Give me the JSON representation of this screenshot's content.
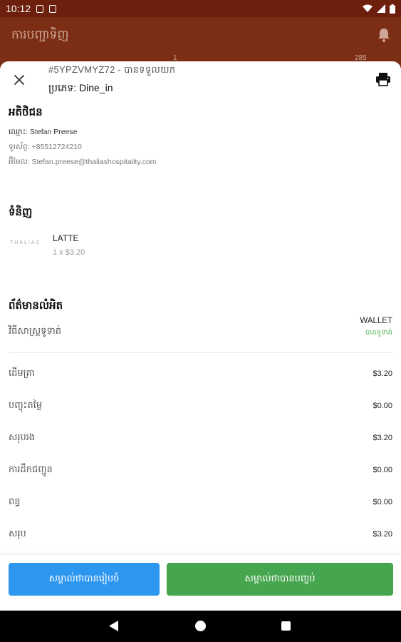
{
  "status_bar": {
    "time": "10:12"
  },
  "app_bar": {
    "title": "ការបញ្ជាទិញ",
    "count_left": "1",
    "count_right": "285"
  },
  "sheet": {
    "order_line": "#5YPZVMYZ72 - បានទទួលយក",
    "order_type": "ប្រភេទ: Dine_in"
  },
  "customer": {
    "title": "អតិថិជន",
    "name_label": "ឈ្មោះ:",
    "name": "Stefan Preese",
    "phone_label": "ទូរស័ព្ទ:",
    "phone": "+85512724210",
    "email_label": "អ៊ីមែល:",
    "email": "Stefan.preese@thaliashospitality.com"
  },
  "products": {
    "title": "ទំនិញ",
    "items": [
      {
        "logo_text": "THALIAS",
        "name": "LATTE",
        "qty_price": "1 x $3.20"
      }
    ]
  },
  "payment": {
    "title": "ព័ត៌មានលំអិត",
    "method_label": "វិធីសាស្រ្តទូទាត់",
    "method": "WALLET",
    "status": "បានទូទាត់",
    "rows": [
      {
        "label": "ដើមគ្រា",
        "value": "$3.20"
      },
      {
        "label": "បញ្ចុះតម្លៃ",
        "value": "$0.00"
      },
      {
        "label": "សរុបរង",
        "value": "$3.20"
      },
      {
        "label": "ការដឹកជញ្ជូន",
        "value": "$0.00"
      },
      {
        "label": "ពន្ធ",
        "value": "$0.00"
      },
      {
        "label": "សរុប",
        "value": "$3.20"
      }
    ]
  },
  "buttons": {
    "prepare": "សម្គាល់ថាបានរៀបចំ",
    "complete": "សម្គាល់ថាបានបញ្ចប់"
  },
  "colors": {
    "status_bar": "#6b1f0c",
    "app_bar": "#7b2e13",
    "prepare_button": "#2d97f0",
    "complete_button": "#46a64f",
    "paid_status": "#5cb85c"
  }
}
